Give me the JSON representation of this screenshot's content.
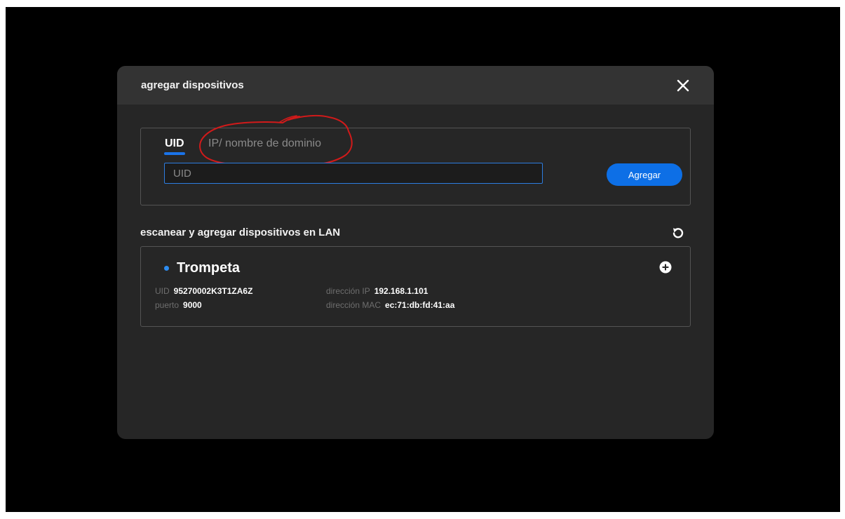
{
  "dialog": {
    "title": "agregar dispositivos"
  },
  "tabs": [
    {
      "label": "UID",
      "active": true
    },
    {
      "label": "IP/ nombre de dominio",
      "active": false
    }
  ],
  "uid_input": {
    "value": "",
    "placeholder": "UID"
  },
  "add_button": {
    "label": "Agregar"
  },
  "lan_section": {
    "title": "escanear y agregar dispositivos en LAN"
  },
  "device": {
    "name": "Trompeta",
    "uid_label": "UID",
    "uid_value": "95270002K3T1ZA6Z",
    "port_label": "puerto",
    "port_value": "9000",
    "ip_label": "dirección IP",
    "ip_value": "192.168.1.101",
    "mac_label": "dirección MAC",
    "mac_value": "ec:71:db:fd:41:aa"
  },
  "icons": {
    "close": "close-icon",
    "refresh": "refresh-icon",
    "add_device": "plus-circle-icon",
    "status": "status-dot-icon"
  },
  "colors": {
    "accent": "#0d6fe6",
    "annotation": "#d11a1a",
    "background": "#000000",
    "dialog": "#262626"
  }
}
